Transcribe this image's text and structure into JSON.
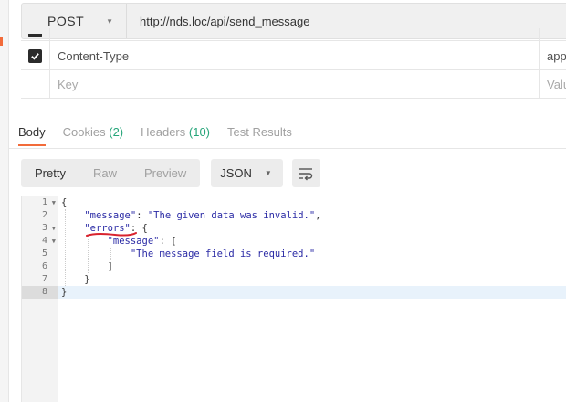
{
  "request": {
    "method": "POST",
    "url": "http://nds.loc/api/send_message"
  },
  "headers_table": {
    "rows": [
      {
        "key": "Content-Type",
        "value": "applicat",
        "checked": true
      },
      {
        "key_placeholder": "Key",
        "value_placeholder": "Value"
      }
    ]
  },
  "response_tabs": [
    {
      "label": "Body",
      "count": ""
    },
    {
      "label": "Cookies",
      "count": "(2)"
    },
    {
      "label": "Headers",
      "count": "(10)"
    },
    {
      "label": "Test Results",
      "count": ""
    }
  ],
  "toolbar": {
    "views": [
      "Pretty",
      "Raw",
      "Preview"
    ],
    "active_view": "Pretty",
    "language": "JSON"
  },
  "response_body": {
    "lines": [
      {
        "num": "1",
        "fold": true
      },
      {
        "num": "2",
        "fold": false
      },
      {
        "num": "3",
        "fold": true
      },
      {
        "num": "4",
        "fold": true
      },
      {
        "num": "5",
        "fold": false
      },
      {
        "num": "6",
        "fold": false
      },
      {
        "num": "7",
        "fold": false
      },
      {
        "num": "8",
        "fold": false
      }
    ],
    "text": {
      "l1": "{",
      "l2_key": "\"message\"",
      "l2_sep": ": ",
      "l2_val": "\"The given data was invalid.\"",
      "l2_end": ",",
      "l3_key": "\"errors\"",
      "l3_rest": ": {",
      "l4_key": "\"message\"",
      "l4_rest": ": [",
      "l5_val": "\"The message field is required.\"",
      "l6": "]",
      "l7": "}",
      "l8": "}"
    },
    "active_line": 8
  },
  "colors": {
    "accent": "#f26b3a",
    "count_green": "#26a57a",
    "json_string": "#2a2aa5",
    "annotation_red": "#d9232e"
  }
}
